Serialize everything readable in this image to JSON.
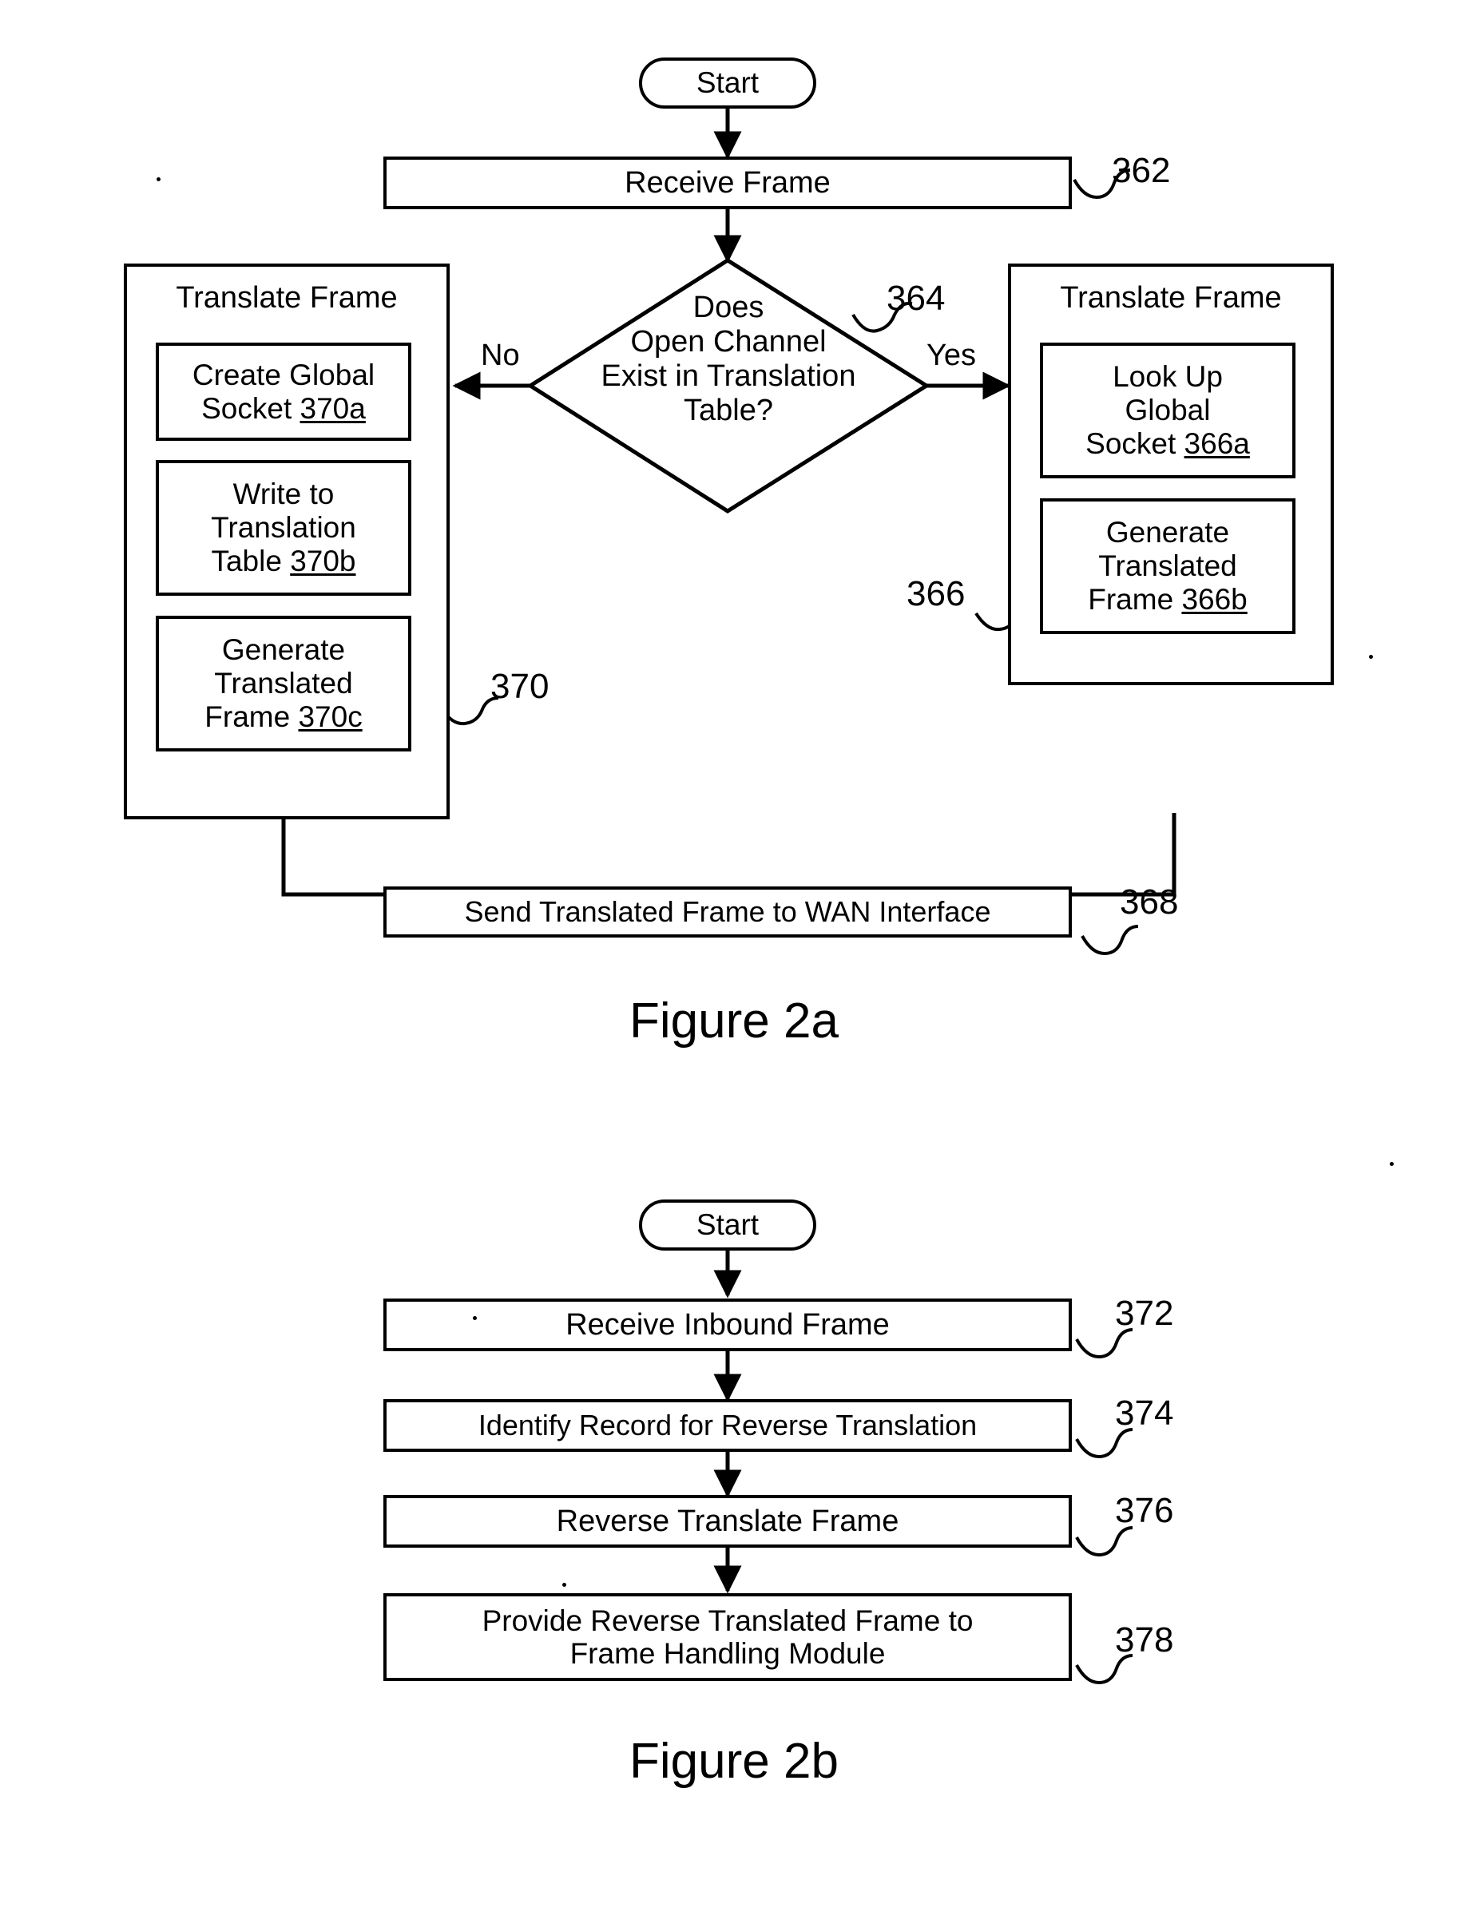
{
  "figure_a": {
    "caption": "Figure 2a",
    "start": {
      "label": "Start"
    },
    "receive_frame": {
      "label": "Receive Frame",
      "ref": "362"
    },
    "decision": {
      "text": "Does\nOpen Channel\nExist in Translation\nTable?",
      "ref": "364",
      "no_label": "No",
      "yes_label": "Yes"
    },
    "left_group": {
      "title": "Translate Frame",
      "ref": "370",
      "steps": [
        {
          "line1": "Create Global",
          "line2": "Socket ",
          "ref": "370a"
        },
        {
          "line1": "Write to",
          "line2": "Translation",
          "line3": "Table ",
          "ref": "370b"
        },
        {
          "line1": "Generate",
          "line2": "Translated",
          "line3": "Frame ",
          "ref": "370c"
        }
      ]
    },
    "right_group": {
      "title": "Translate Frame",
      "ref": "366",
      "steps": [
        {
          "line1": "Look Up",
          "line2": "Global",
          "line3": "Socket ",
          "ref": "366a"
        },
        {
          "line1": "Generate",
          "line2": "Translated",
          "line3": "Frame ",
          "ref": "366b"
        }
      ]
    },
    "send_frame": {
      "label": "Send Translated Frame to WAN Interface",
      "ref": "368"
    }
  },
  "figure_b": {
    "caption": "Figure 2b",
    "start": {
      "label": "Start"
    },
    "steps": [
      {
        "label": "Receive Inbound Frame",
        "ref": "372"
      },
      {
        "label": "Identify Record for Reverse Translation",
        "ref": "374"
      },
      {
        "label": "Reverse Translate Frame",
        "ref": "376"
      },
      {
        "line1": "Provide Reverse Translated Frame to",
        "line2": "Frame Handling Module",
        "ref": "378"
      }
    ]
  },
  "colors": {
    "ink": "#000000",
    "paper": "#ffffff"
  }
}
